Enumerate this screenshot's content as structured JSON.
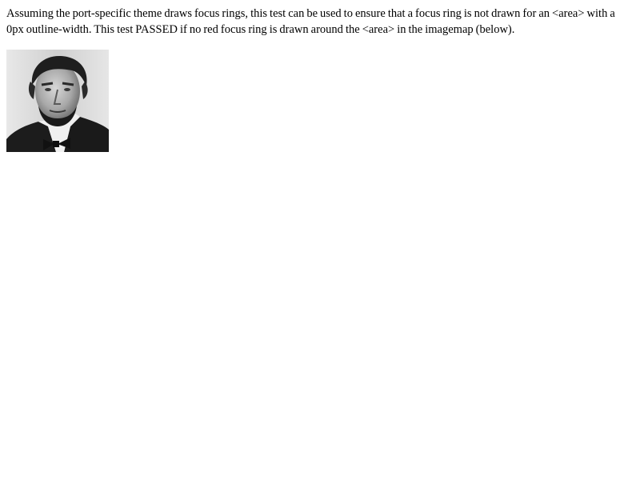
{
  "description": "Assuming the port-specific theme draws focus rings, this test can be used to ensure that a focus ring is not drawn for an <area> with a 0px outline-width. This test PASSED if no red focus ring is drawn around the <area> in the imagemap (below).",
  "imagemap": {
    "image": "portrait-photo",
    "area": "area-link"
  }
}
